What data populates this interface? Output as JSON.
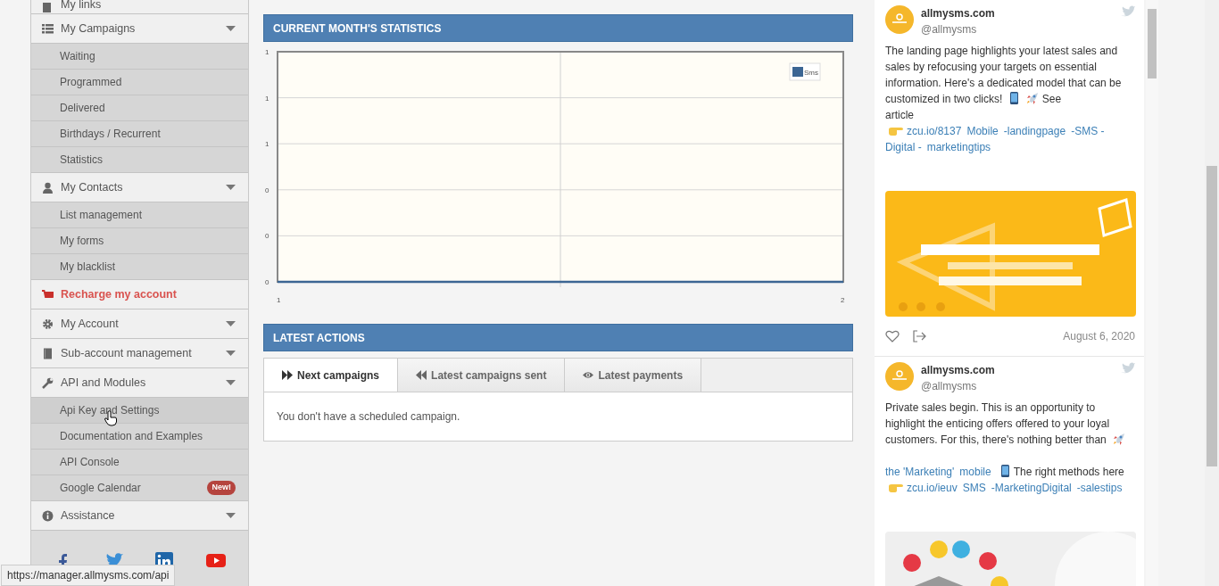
{
  "sidebar": {
    "items": [
      {
        "kind": "link",
        "label": "My links"
      },
      {
        "kind": "group",
        "label": "My Campaigns",
        "children": [
          {
            "label": "Waiting",
            "hovered": false
          },
          {
            "label": "Programmed",
            "hovered": false
          },
          {
            "label": "Delivered",
            "hovered": false
          },
          {
            "label": "Birthdays / Recurrent",
            "hovered": false
          },
          {
            "label": "Statistics",
            "hovered": false
          }
        ]
      },
      {
        "kind": "group",
        "label": "My Contacts",
        "children": [
          {
            "label": "List management",
            "hovered": false
          },
          {
            "label": "My forms",
            "hovered": false
          },
          {
            "label": "My blacklist",
            "hovered": false
          }
        ]
      },
      {
        "kind": "highlight",
        "label": "Recharge my account"
      },
      {
        "kind": "group",
        "label": "My Account"
      },
      {
        "kind": "group",
        "label": "Sub-account management"
      },
      {
        "kind": "group",
        "label": "API and Modules",
        "children": [
          {
            "label": "Api Key and Settings",
            "hovered": true
          },
          {
            "label": "Documentation and Examples",
            "hovered": false
          },
          {
            "label": "API Console",
            "hovered": false
          },
          {
            "label": "Google Calendar",
            "badge": "New!",
            "hovered": false
          }
        ]
      },
      {
        "kind": "group",
        "label": "Assistance"
      }
    ]
  },
  "statistics": {
    "title": "CURRENT MONTH'S STATISTICS",
    "chart_data": {
      "type": "line",
      "grid": true,
      "ref_lines": [
        {
          "axis": "x",
          "value": 1.5
        }
      ],
      "x": [
        1,
        2
      ],
      "series": [
        {
          "name": "Sms",
          "color": "#3b6593",
          "values": [
            0,
            0
          ]
        }
      ],
      "xlim": [
        1,
        2
      ],
      "ylim": [
        0,
        1
      ],
      "xticks": [
        1,
        2
      ],
      "yticks": [
        {
          "value": 0,
          "label": "0"
        },
        {
          "value": 0.2,
          "label": "0"
        },
        {
          "value": 0.4,
          "label": "0"
        },
        {
          "value": 0.6,
          "label": "1"
        },
        {
          "value": 0.8,
          "label": "1"
        },
        {
          "value": 1,
          "label": "1"
        }
      ]
    }
  },
  "latest_actions": {
    "title": "LATEST ACTIONS",
    "tabs": [
      {
        "label": "Next campaigns",
        "selected": true
      },
      {
        "label": "Latest campaigns sent",
        "selected": false
      },
      {
        "label": "Latest payments",
        "selected": false
      }
    ],
    "message": "You don't have a scheduled campaign."
  },
  "timeline": {
    "tweets": [
      {
        "name": "allmysms.com",
        "handle": "@allmysms",
        "date": "August 6, 2020",
        "body": [
          {
            "kind": "text",
            "text": "The landing page highlights your latest sales and sales by refocusing your targets on essential information. Here's a dedicated model that can be customized in two clicks!"
          },
          {
            "kind": "phone-emoji"
          },
          {
            "kind": "rocket-emoji"
          },
          {
            "kind": "text",
            "text": "See"
          },
          {
            "kind": "break"
          },
          {
            "kind": "text",
            "text": "article"
          },
          {
            "kind": "break"
          },
          {
            "kind": "hand-emoji"
          },
          {
            "kind": "link",
            "text": "zcu.io/8137"
          },
          {
            "kind": "link",
            "text": "Mobile"
          },
          {
            "kind": "link",
            "text": "-landingpage"
          },
          {
            "kind": "link",
            "text": "-SMS -"
          },
          {
            "kind": "break"
          },
          {
            "kind": "link",
            "text": "Digital -"
          },
          {
            "kind": "link",
            "text": "marketingtips"
          }
        ],
        "media": {
          "kind": "picture"
        }
      },
      {
        "name": "allmysms.com",
        "handle": "@allmysms",
        "body": [
          {
            "kind": "text",
            "text": "Private sales begin. This is an opportunity to highlight the enticing offers offered to your loyal customers. For this, there's nothing better than"
          },
          {
            "kind": "rocket-emoji"
          },
          {
            "kind": "break"
          },
          {
            "kind": "break"
          },
          {
            "kind": "link",
            "text": "the 'Marketing'"
          },
          {
            "kind": "link",
            "text": "mobile"
          },
          {
            "kind": "phone-emoji"
          },
          {
            "kind": "text",
            "text": "The right methods here"
          },
          {
            "kind": "break"
          },
          {
            "kind": "hand-emoji"
          },
          {
            "kind": "link",
            "text": "zcu.io/ieuv"
          },
          {
            "kind": "link",
            "text": "SMS"
          },
          {
            "kind": "link",
            "text": "-MarketingDigital"
          },
          {
            "kind": "link",
            "text": "-salestips"
          }
        ],
        "media": {
          "kind": "picture"
        }
      }
    ]
  },
  "status_bar": {
    "url": "https://manager.allmysms.com/api"
  }
}
